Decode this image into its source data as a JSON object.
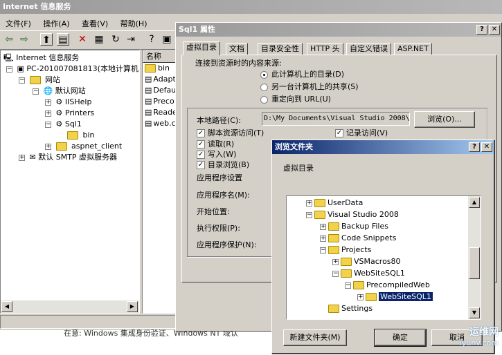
{
  "main_window": {
    "title": "Internet 信息服务",
    "menu": [
      "文件(F)",
      "操作(A)",
      "查看(V)",
      "帮助(H)"
    ],
    "toolbar_icons": [
      "back-icon",
      "forward-icon",
      "up-icon",
      "show-tree-icon",
      "delete-icon",
      "properties-icon",
      "refresh-icon",
      "export-icon",
      "help-icon",
      "computer-icon"
    ]
  },
  "tree": {
    "root": "Internet 信息服务",
    "computer": "PC-201007081813(本地计算机",
    "websites": "网站",
    "default_site": "默认网站",
    "iishelp": "IISHelp",
    "printers": "Printers",
    "sql1": "Sql1",
    "bin": "bin",
    "aspnet_client": "aspnet_client",
    "smtp": "默认 SMTP 虚拟服务器"
  },
  "list": {
    "header": "名称",
    "items": [
      "bin",
      "Adapt",
      "Defau",
      "Preco",
      "Reade",
      "web.c"
    ]
  },
  "props": {
    "title": "Sql1 属性",
    "tabs": [
      "虚拟目录",
      "文档",
      "目录安全性",
      "HTTP 头",
      "自定义错误",
      "ASP.NET"
    ],
    "content_source_label": "连接到资源时的内容来源:",
    "radio_local": "此计算机上的目录(D)",
    "radio_share": "另一台计算机上的共享(S)",
    "radio_redirect": "重定向到 URL(U)",
    "local_path_label": "本地路径(C):",
    "local_path_value": "D:\\My Documents\\Visual Studio 2008\\",
    "browse_button": "浏览(O)...",
    "chk_script": "脚本资源访问(T)",
    "chk_read": "读取(R)",
    "chk_write": "写入(W)",
    "chk_browse": "目录浏览(B)",
    "chk_log": "记录访问(V)",
    "app_settings": "应用程序设置",
    "app_name": "应用程序名(M):",
    "start_point": "开始位置:",
    "exec_perm": "执行权限(P):",
    "app_protect": "应用程序保护(N):"
  },
  "browse": {
    "title": "浏览文件夹",
    "prompt": "虚拟目录",
    "folders": [
      {
        "label": "UserData",
        "exp": "+"
      },
      {
        "label": "Visual Studio 2008",
        "exp": "-"
      },
      {
        "label": "Backup Files",
        "exp": "+"
      },
      {
        "label": "Code Snippets",
        "exp": "+"
      },
      {
        "label": "Projects",
        "exp": "-"
      },
      {
        "label": "VSMacros80",
        "exp": "+"
      },
      {
        "label": "WebSiteSQL1",
        "exp": "-"
      },
      {
        "label": "PrecompiledWeb",
        "exp": "-"
      },
      {
        "label": "WebSiteSQL1",
        "exp": "+"
      },
      {
        "label": "Settings",
        "exp": ""
      }
    ],
    "selected": "WebSiteSQL1",
    "new_folder_button": "新建文件夹(M)",
    "ok_button": "确定",
    "cancel_button": "取消"
  },
  "background_text": "在意: Windows 集成身份验证、Windows NT 域认",
  "watermark": {
    "line1": "运维网",
    "line2": "iyunv.com"
  }
}
